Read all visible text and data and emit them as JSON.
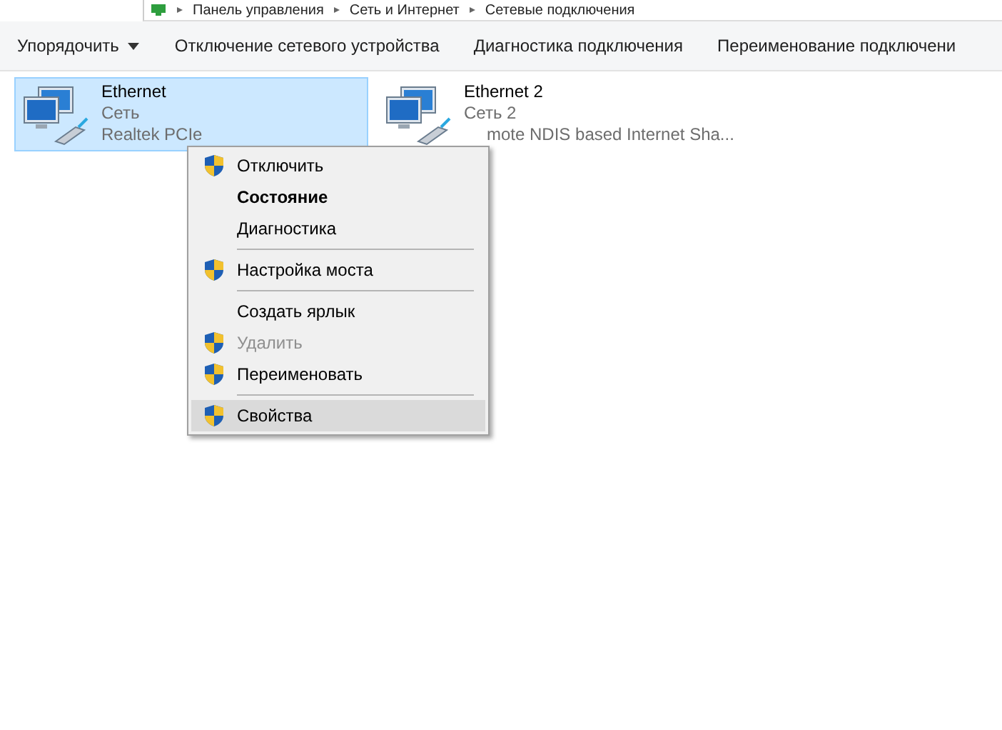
{
  "address_bar": {
    "path": [
      "Панель управления",
      "Сеть и Интернет",
      "Сетевые подключения"
    ]
  },
  "toolbar": {
    "items": [
      {
        "label": "Упорядочить",
        "kind": "dropdown"
      },
      {
        "label": "Отключение сетевого устройства",
        "kind": "button"
      },
      {
        "label": "Диагностика подключения",
        "kind": "button"
      },
      {
        "label": "Переименование подключени",
        "kind": "button"
      }
    ]
  },
  "connections": [
    {
      "name": "Ethernet",
      "network": "Сеть",
      "adapter": "Realtek PCIe",
      "selected": true
    },
    {
      "name": "Ethernet 2",
      "network": "Сеть 2",
      "adapter": "mote NDIS based Internet Sha...",
      "selected": false
    }
  ],
  "context_menu": {
    "items": [
      {
        "kind": "item",
        "label": "Отключить",
        "shield": true,
        "bold": false,
        "disabled": false,
        "selected": false
      },
      {
        "kind": "item",
        "label": "Состояние",
        "shield": false,
        "bold": true,
        "disabled": false,
        "selected": false
      },
      {
        "kind": "item",
        "label": "Диагностика",
        "shield": false,
        "bold": false,
        "disabled": false,
        "selected": false
      },
      {
        "kind": "separator"
      },
      {
        "kind": "item",
        "label": "Настройка моста",
        "shield": true,
        "bold": false,
        "disabled": false,
        "selected": false
      },
      {
        "kind": "separator"
      },
      {
        "kind": "item",
        "label": "Создать ярлык",
        "shield": false,
        "bold": false,
        "disabled": false,
        "selected": false
      },
      {
        "kind": "item",
        "label": "Удалить",
        "shield": true,
        "bold": false,
        "disabled": true,
        "selected": false
      },
      {
        "kind": "item",
        "label": "Переименовать",
        "shield": true,
        "bold": false,
        "disabled": false,
        "selected": false
      },
      {
        "kind": "separator"
      },
      {
        "kind": "item",
        "label": "Свойства",
        "shield": true,
        "bold": false,
        "disabled": false,
        "selected": true
      }
    ]
  }
}
